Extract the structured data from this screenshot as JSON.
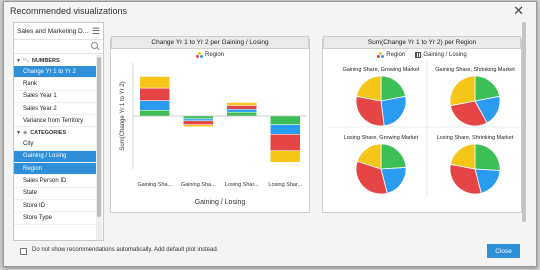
{
  "dialog": {
    "title": "Recommended visualizations",
    "close_glyph": "✕"
  },
  "left_panel": {
    "data_source": "Sales and Marketing D...",
    "menu_glyph": "☰",
    "numbers_header": "NUMBERS",
    "numbers_fields": [
      "Change Yr 1 to Yr 2",
      "Rank",
      "Sales Year 1",
      "Sales Year 2",
      "Variance from Territory"
    ],
    "categories_header": "CATEGORIES",
    "categories_fields": [
      "City",
      "Gaining / Losing",
      "Region",
      "Sales Person ID",
      "State",
      "Store ID",
      "Store Type"
    ],
    "selected": [
      "Change Yr 1 to Yr 2",
      "Gaining / Losing",
      "Region"
    ]
  },
  "bar_card": {
    "title": "Change Yr 1 to Yr 2 per Gaining / Losing",
    "legend_label": "Region",
    "ylabel": "Sum(Change Yr 1 to Yr 2)",
    "xlabel": "Gaining / Losing",
    "tick_labels": [
      "Gaining Sha...",
      "Gaining Sha...",
      "Losing Shar...",
      "Losing Shar..."
    ]
  },
  "pie_card": {
    "title": "Sum(Change Yr 1 to Yr 2) per Region",
    "legend_region": "Region",
    "legend_gl": "Gaining / Losing",
    "panel_titles": [
      "Gaining Share, Growing Market",
      "Gaining Share, Shrinking Market",
      "Losing Share, Growing Market",
      "Losing Share, Shrinking Market"
    ]
  },
  "footer": {
    "checkbox_label": "Do not show recommendations automatically. Add default plot instead.",
    "close_label": "Close"
  },
  "colors": {
    "accent": "#2f8fd8",
    "yellow": "#f5c518",
    "red": "#e64545",
    "blue": "#2a9cf0",
    "green": "#3dbf57"
  },
  "chart_data": [
    {
      "type": "bar",
      "title": "Change Yr 1 to Yr 2 per Gaining / Losing",
      "xlabel": "Gaining / Losing",
      "ylabel": "Sum(Change Yr 1 to Yr 2)",
      "categories": [
        "Gaining Sha...",
        "Gaining Sha...",
        "Losing Shar...",
        "Losing Shar..."
      ],
      "ylim": [
        -55,
        55
      ],
      "legend": "top",
      "grid": false,
      "series": [
        {
          "name": "",
          "color": "#3dbf57",
          "values": [
            6,
            -3,
            4,
            -9
          ]
        },
        {
          "name": "",
          "color": "#2a9cf0",
          "values": [
            10,
            -2,
            3,
            -10
          ]
        },
        {
          "name": "",
          "color": "#e64545",
          "values": [
            13,
            -4,
            4,
            -17
          ]
        },
        {
          "name": "",
          "color": "#f5c518",
          "values": [
            12,
            -2,
            3,
            -12
          ]
        }
      ]
    },
    {
      "type": "pie",
      "title": "Sum(Change Yr 1 to Yr 2) per Region",
      "legend": "top",
      "panels": [
        {
          "title": "Gaining Share, Growing Market",
          "slices": [
            {
              "color": "#3dbf57",
              "value": 22
            },
            {
              "color": "#2a9cf0",
              "value": 26
            },
            {
              "color": "#e64545",
              "value": 30
            },
            {
              "color": "#f5c518",
              "value": 22
            }
          ]
        },
        {
          "title": "Gaining Share, Shrinking Market",
          "slices": [
            {
              "color": "#3dbf57",
              "value": 22
            },
            {
              "color": "#2a9cf0",
              "value": 20
            },
            {
              "color": "#e64545",
              "value": 30
            },
            {
              "color": "#f5c518",
              "value": 28
            }
          ]
        },
        {
          "title": "Losing Share, Growing Market",
          "slices": [
            {
              "color": "#3dbf57",
              "value": 24
            },
            {
              "color": "#2a9cf0",
              "value": 22
            },
            {
              "color": "#e64545",
              "value": 34
            },
            {
              "color": "#f5c518",
              "value": 20
            }
          ]
        },
        {
          "title": "Losing Share, Shrinking Market",
          "slices": [
            {
              "color": "#3dbf57",
              "value": 26
            },
            {
              "color": "#2a9cf0",
              "value": 20
            },
            {
              "color": "#e64545",
              "value": 32
            },
            {
              "color": "#f5c518",
              "value": 22
            }
          ]
        }
      ]
    }
  ]
}
